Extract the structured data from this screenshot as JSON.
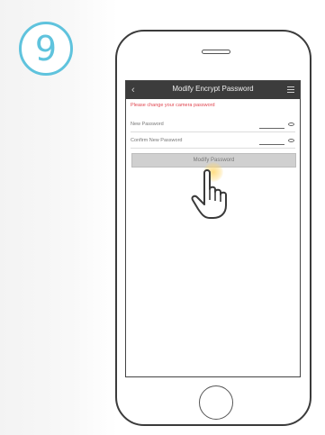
{
  "step": {
    "number": "9"
  },
  "app": {
    "title": "Modify Encrypt Password",
    "notice": "Please change your camera password",
    "fields": [
      {
        "label": "New Password",
        "value": "••••••"
      },
      {
        "label": "Confirm New Password",
        "value": ""
      }
    ],
    "button_label": "Modify Password"
  },
  "icons": {
    "back": "back-arrow-icon",
    "menu": "menu-icon",
    "eye": "eye-icon",
    "pointer": "hand-pointer-icon"
  },
  "colors": {
    "step_accent": "#5fc3dd",
    "app_bar": "#3c3c3c",
    "notice": "#e0454f",
    "button": "#d0d0d0"
  }
}
